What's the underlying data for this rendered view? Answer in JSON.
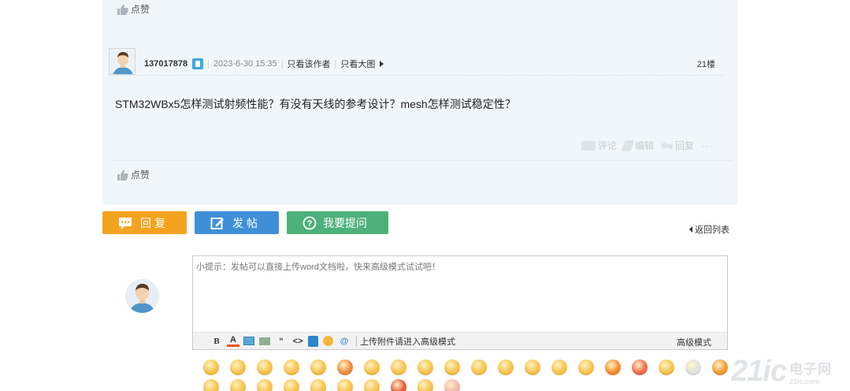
{
  "previous_post": {
    "like_label": "点赞"
  },
  "post": {
    "username": "137017878",
    "timestamp": "2023-6-30 15:35",
    "only_author_link": "只看该作者",
    "only_image_link": "只看大图",
    "floor": "21楼",
    "content": "STM32WBx5怎样测试射频性能？有没有天线的参考设计？mesh怎样测试稳定性？",
    "actions": {
      "comment": "评论",
      "edit": "编辑",
      "reply": "回复",
      "more": "···"
    },
    "like_label": "点赞"
  },
  "buttons": {
    "reply": "回复",
    "post": "发帖",
    "ask": "我要提问"
  },
  "back_to_list": "返回列表",
  "editor": {
    "placeholder": "小提示：发帖可以直接上传word文档啦，快来高级模式试试吧！",
    "toolbar": {
      "bold": "B",
      "color": "A",
      "quote": "“",
      "code": "<>",
      "mention": "@",
      "upload_label": "上传附件请进入高级模式",
      "advanced_mode": "高级模式"
    }
  },
  "smilies": {
    "row1_colors": [
      "#f7c24a",
      "#f7c24a",
      "#f7c24a",
      "#f7c24a",
      "#f7c24a",
      "#f08a3c",
      "#f7c24a",
      "#f7c24a",
      "#f7c24a",
      "#f7c24a",
      "#f7c24a",
      "#f7c24a",
      "#f7c24a",
      "#f7c24a",
      "#f7c24a",
      "#f58c2e",
      "#f06a4a",
      "#f7c24a",
      "#e2e2e2",
      "#f39a33"
    ],
    "row2_colors": [
      "#f7c24a",
      "#f7c24a",
      "#f7c24a",
      "#f7c24a",
      "#f7c24a",
      "#f7c24a",
      "#f7c24a",
      "#e55a3a",
      "#f7c24a",
      "#f4b5a8"
    ]
  },
  "watermark": {
    "big": "21ic",
    "cn": "电子网",
    "en": "21ic.com"
  }
}
